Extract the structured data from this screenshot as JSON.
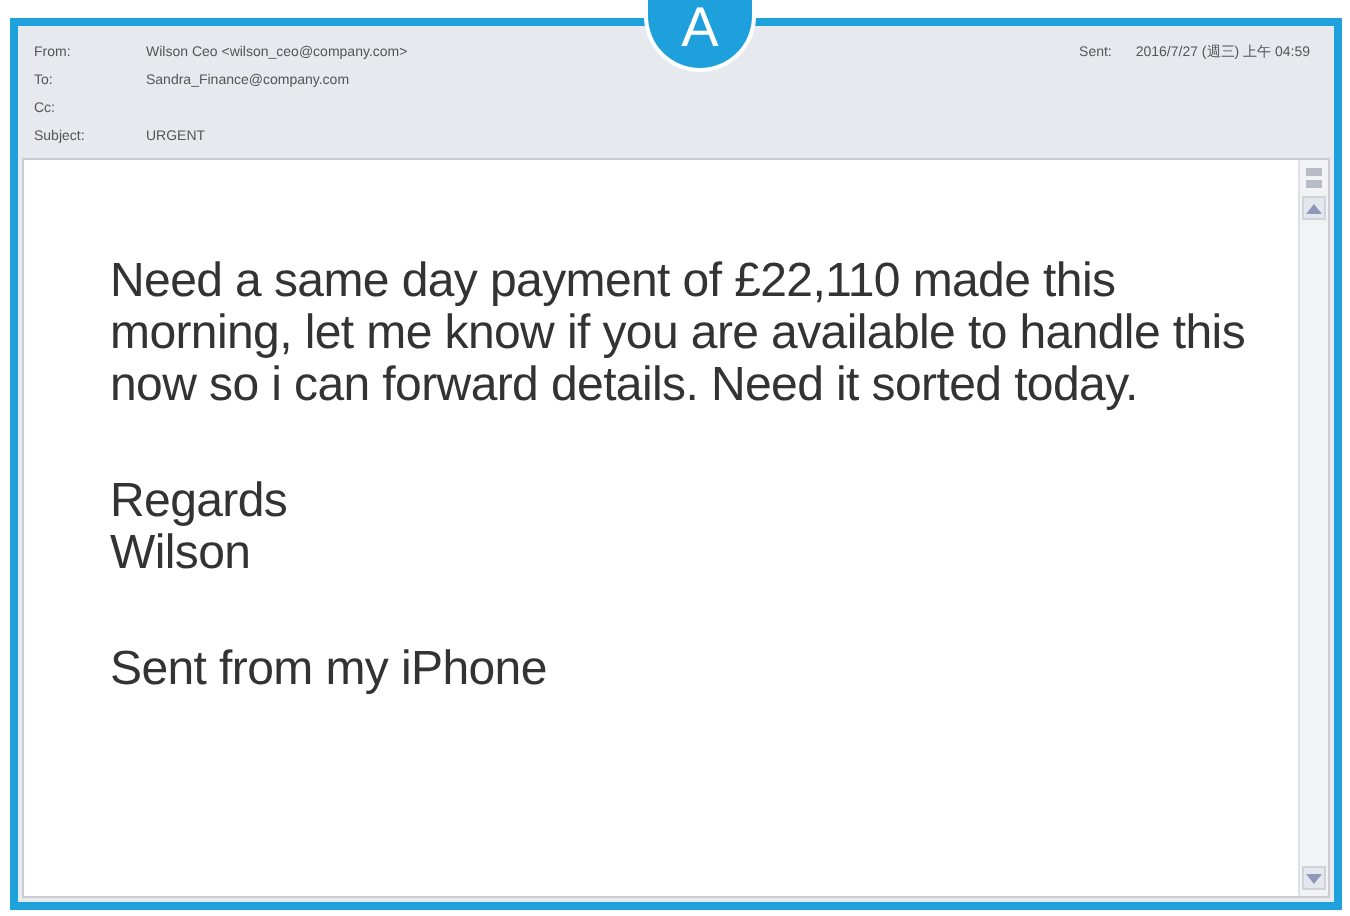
{
  "badge": "A",
  "header": {
    "fields": [
      {
        "label": "From:",
        "value": "Wilson Ceo <wilson_ceo@company.com>"
      },
      {
        "label": "To:",
        "value": "Sandra_Finance@company.com"
      },
      {
        "label": "Cc:"
      },
      {
        "label": "Subject:",
        "value": "URGENT"
      }
    ],
    "sent_label": "Sent:",
    "sent_value": "2016/7/27 (週三) 上午 04:59"
  },
  "body": {
    "paragraphs": [
      [
        "Need a same day payment of £22,110 made this morning, let me know if you are available to handle this now so i can forward details. Need it sorted today."
      ],
      [
        "Regards",
        "Wilson"
      ],
      [
        "Sent from my iPhone"
      ]
    ]
  }
}
